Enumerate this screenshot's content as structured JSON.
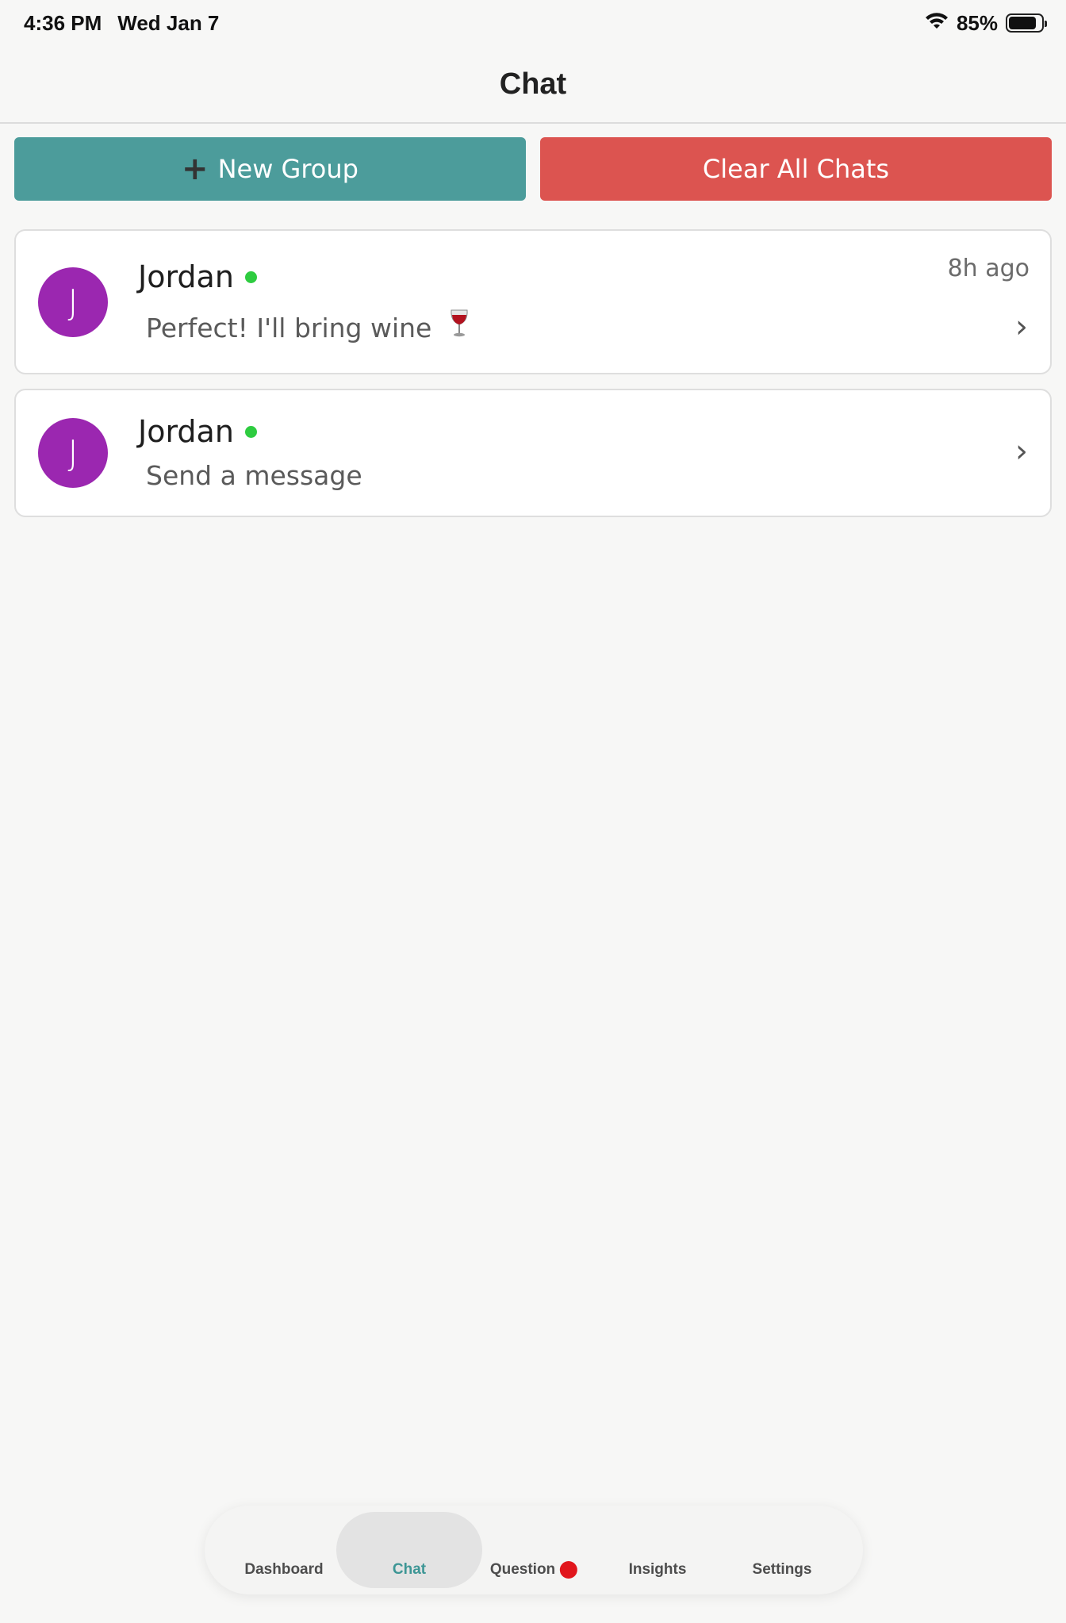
{
  "status_bar": {
    "time": "4:36 PM",
    "date": "Wed Jan 7",
    "battery_percent": "85%",
    "battery_level": 0.85
  },
  "header": {
    "title": "Chat"
  },
  "actions": {
    "new_group_label": "New Group",
    "clear_all_label": "Clear All Chats"
  },
  "chats": [
    {
      "initial": "J",
      "name": "Jordan",
      "online": true,
      "preview": "Perfect! I'll bring wine",
      "time": "8h ago"
    },
    {
      "initial": "J",
      "name": "Jordan",
      "online": true,
      "preview": "Send a message"
    }
  ],
  "tabbar": {
    "dashboard": "Dashboard",
    "chat": "Chat",
    "question": "Question",
    "insights": "Insights",
    "settings": "Settings",
    "active": "Chat"
  },
  "colors": {
    "teal": "#4c9c9b",
    "red": "#dc5450",
    "avatar": "#9b27b0",
    "online": "#2ecc40"
  }
}
